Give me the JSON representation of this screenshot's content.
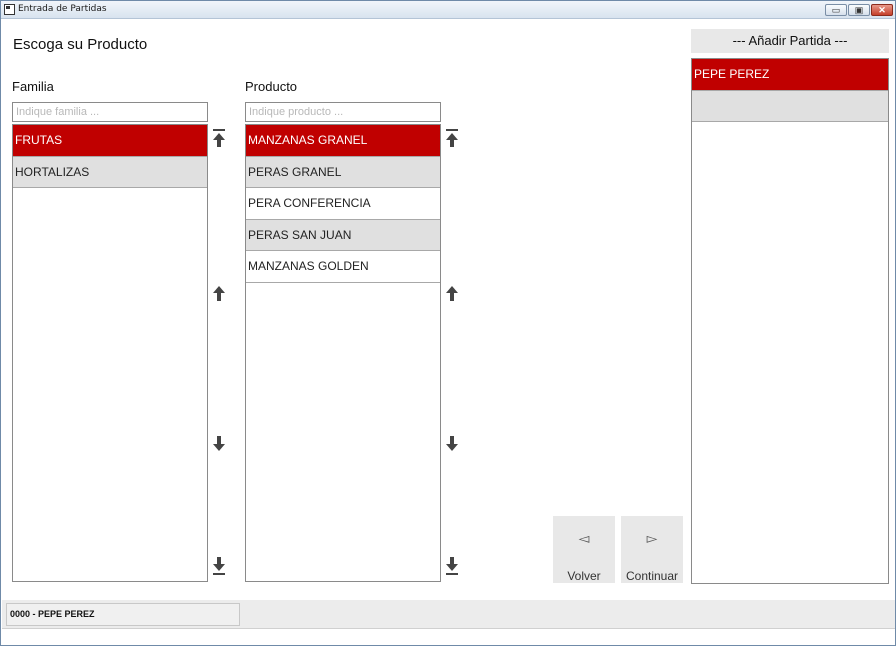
{
  "window": {
    "title": "Entrada de Partidas",
    "min_glyph": "▭",
    "max_glyph": "▣",
    "close_glyph": "✕"
  },
  "page": {
    "title": "Escoga su Producto"
  },
  "familia": {
    "label": "Familia",
    "placeholder": "Indique familia ...",
    "items": [
      "FRUTAS",
      "HORTALIZAS"
    ]
  },
  "producto": {
    "label": "Producto",
    "placeholder": "Indique producto ...",
    "items": [
      "MANZANAS GRANEL",
      "PERAS GRANEL",
      "PERA CONFERENCIA",
      "PERAS SAN JUAN",
      "MANZANAS GOLDEN"
    ]
  },
  "actions": {
    "back_glyph": "◅",
    "back_label": "Volver",
    "next_glyph": "▻",
    "next_label": "Continuar"
  },
  "partida": {
    "header": "--- Añadir Partida ---",
    "items": [
      "PEPE PEREZ",
      ""
    ]
  },
  "status": {
    "text": "0000  -  PEPE PEREZ"
  },
  "colors": {
    "selected": "#c00000",
    "alternate": "#e0e0e0"
  }
}
